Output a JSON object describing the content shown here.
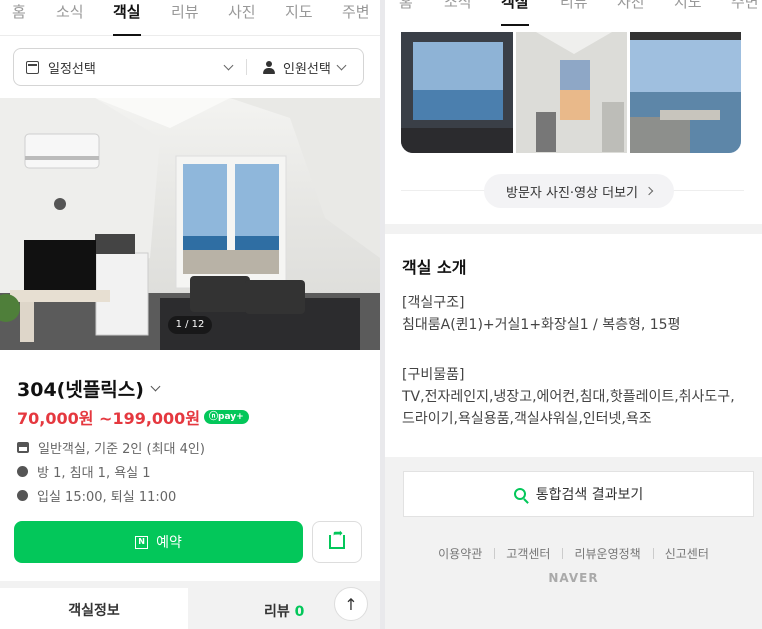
{
  "tabs": [
    "홈",
    "소식",
    "객실",
    "리뷰",
    "사진",
    "지도",
    "주변"
  ],
  "active_tab": "객실",
  "filter": {
    "date_label": "일정선택",
    "people_label": "인원선택"
  },
  "photo": {
    "counter": "1 / 12"
  },
  "room": {
    "name": "304(넷플릭스)",
    "price": "70,000원 ~199,000원",
    "npay": "ⓝpay+",
    "type_line": "일반객실, 기준 2인 (최대 4인)",
    "rooms_line": "방 1, 침대 1, 욕실 1",
    "time_line": "입실 15:00, 퇴실 11:00"
  },
  "reserve_label": "예약",
  "bottom_tabs": {
    "info": "객실정보",
    "review": "리뷰",
    "review_count": "0"
  },
  "totop": "↑",
  "visitor_button": "방문자 사진·영상 더보기",
  "intro": {
    "title": "객실 소개",
    "structure_head": "[객실구조]",
    "structure_text": "침대룸A(퀸1)+거실1+화장실1 / 복층형, 15평",
    "amenity_head": "[구비물품]",
    "amenity_line1": "TV,전자레인지,냉장고,에어컨,침대,핫플레이트,취사도구,",
    "amenity_line2": "드라이기,욕실용품,객실샤워실,인터넷,욕조"
  },
  "search_button": "통합검색 결과보기",
  "footer_links": [
    "이용약관",
    "고객센터",
    "리뷰운영정책",
    "신고센터"
  ],
  "footer_brand": "NAVER",
  "colors": {
    "accent": "#03c75a",
    "price": "#e5383f"
  }
}
